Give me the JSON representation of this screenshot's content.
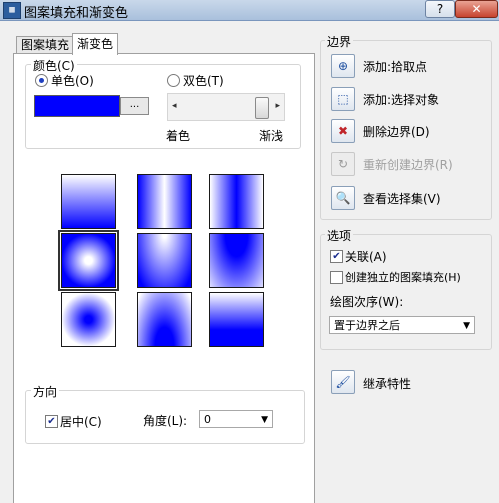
{
  "window": {
    "title": "图案填充和渐变色",
    "help_label": "?",
    "close_label": "✕",
    "app_icon": "hatch-icon"
  },
  "tabs": [
    {
      "label": "图案填充"
    },
    {
      "label": "渐变色"
    }
  ],
  "color": {
    "group_title": "颜色(C)",
    "single_label": "单色(O)",
    "double_label": "双色(T)",
    "single_selected": true,
    "swatch_color": "#0000ff",
    "browse_label": "...",
    "shade_label": "着色",
    "tint_label": "渐浅",
    "slider_level": 0.9
  },
  "gradients": {
    "base_color": "#0000ff",
    "selected_index": 3,
    "patterns": [
      "linear",
      "cylinder",
      "inv-cylinder",
      "spherical",
      "hemispherical",
      "curved",
      "inv-spherical",
      "inv-hemispherical",
      "inv-curved"
    ]
  },
  "orientation": {
    "group_title": "方向",
    "centered_label": "居中(C)",
    "centered_checked": true,
    "angle_label": "角度(L):",
    "angle_value": "0"
  },
  "boundaries": {
    "group_title": "边界",
    "actions": [
      {
        "label": "添加:拾取点",
        "icon": "pick-point-icon",
        "enabled": true
      },
      {
        "label": "添加:选择对象",
        "icon": "select-objects-icon",
        "enabled": true
      },
      {
        "label": "删除边界(D)",
        "icon": "remove-boundary-icon",
        "enabled": true
      },
      {
        "label": "重新创建边界(R)",
        "icon": "recreate-boundary-icon",
        "enabled": false
      },
      {
        "label": "查看选择集(V)",
        "icon": "view-selection-icon",
        "enabled": true
      }
    ]
  },
  "options": {
    "group_title": "选项",
    "associative_label": "关联(A)",
    "associative_checked": true,
    "separate_label": "创建独立的图案填充(H)",
    "separate_checked": false,
    "draw_order_label": "绘图次序(W):",
    "draw_order_value": "置于边界之后"
  },
  "inherit": {
    "label": "继承特性",
    "icon": "inherit-properties-icon"
  }
}
